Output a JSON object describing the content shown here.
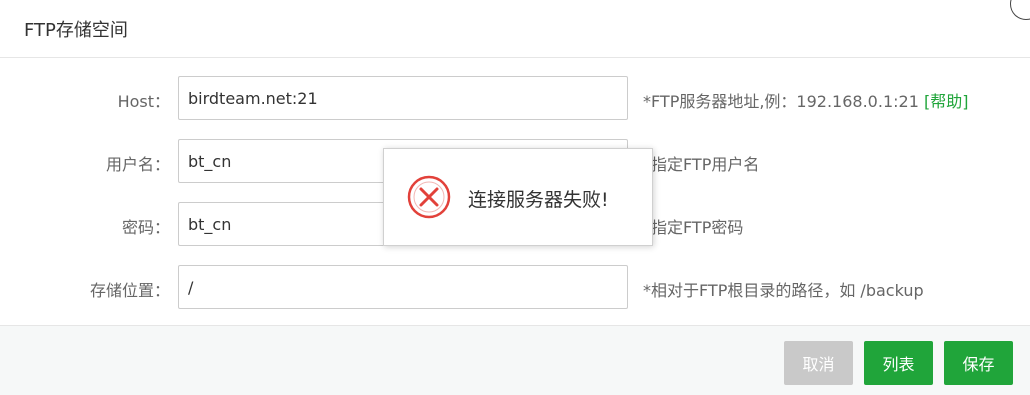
{
  "dialog": {
    "title": "FTP存储空间"
  },
  "form": {
    "host": {
      "label": "Host：",
      "value": "birdteam.net:21",
      "hint": "*FTP服务器地址,例：192.168.0.1:21 ",
      "help_link": "[帮助]"
    },
    "username": {
      "label": "用户名：",
      "value": "bt_cn",
      "hint": "*指定FTP用户名"
    },
    "password": {
      "label": "密码：",
      "value": "bt_cn",
      "hint": "*指定FTP密码"
    },
    "path": {
      "label": "存储位置：",
      "value": "/",
      "hint": "*相对于FTP根目录的路径，如 /backup"
    }
  },
  "footer": {
    "cancel_label": "取消",
    "list_label": "列表",
    "save_label": "保存"
  },
  "toast": {
    "message": "连接服务器失败!",
    "icon": "error-x-circle-icon"
  },
  "colors": {
    "accent": "#20a53a",
    "disabled": "#c9c9c9",
    "error": "#e2413a"
  }
}
